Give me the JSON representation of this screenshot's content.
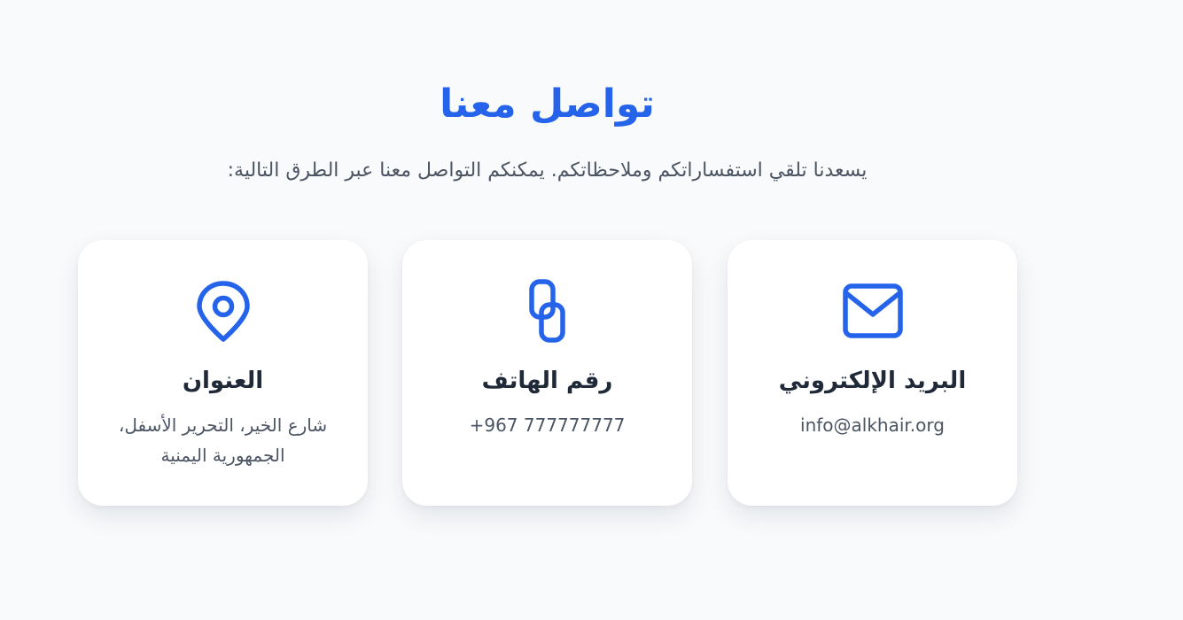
{
  "header": {
    "title": "تواصل معنا",
    "subtitle": "يسعدنا تلقي استفساراتكم وملاحظاتكم. يمكنكم التواصل معنا عبر الطرق التالية:"
  },
  "cards": {
    "email": {
      "icon": "envelope-icon",
      "title": "البريد الإلكتروني",
      "value": "info@alkhair.org"
    },
    "phone": {
      "icon": "link-icon",
      "title": "رقم الهاتف",
      "value": "+967 777777777"
    },
    "address": {
      "icon": "location-pin-icon",
      "title": "العنوان",
      "value": "شارع الخير، التحرير الأسفل، الجمهورية اليمنية"
    }
  },
  "colors": {
    "accent": "#2563eb",
    "heading": "#1f2937",
    "text": "#4b5563",
    "background": "#f8fafc",
    "card": "#ffffff"
  }
}
